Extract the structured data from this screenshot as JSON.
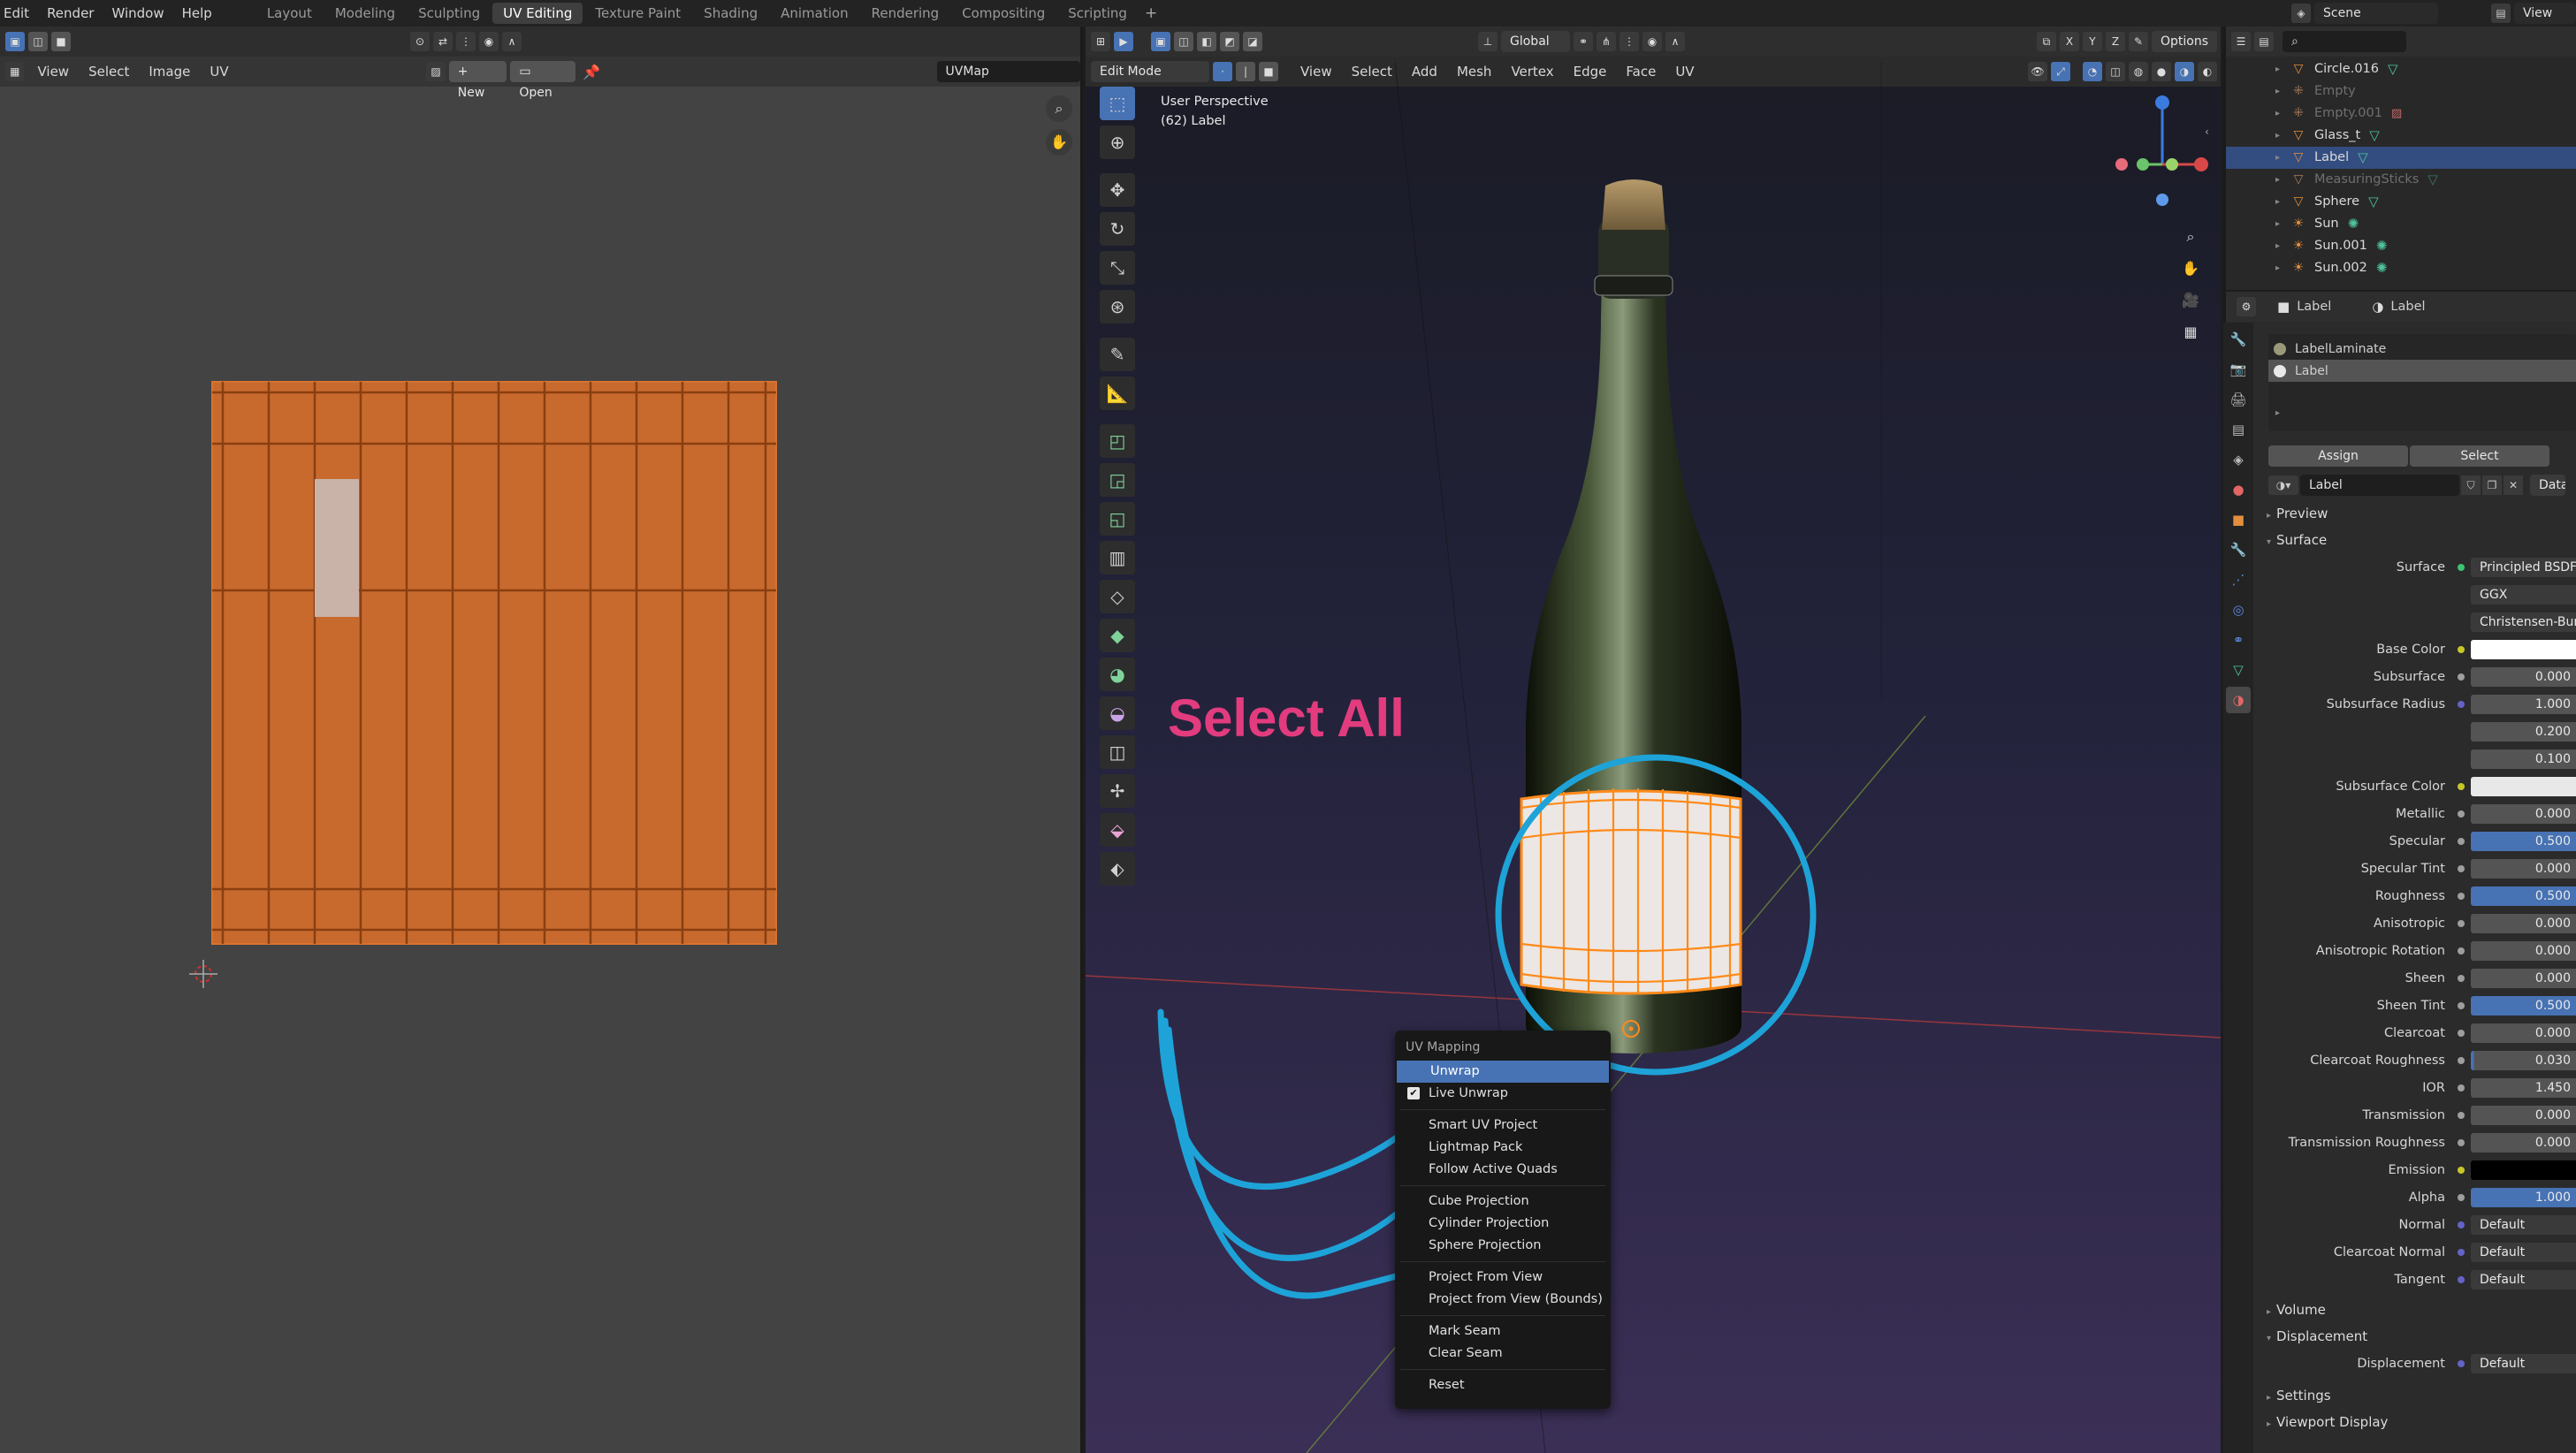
{
  "topbar": {
    "menus": [
      "Edit",
      "Render",
      "Window",
      "Help"
    ],
    "workspaces": [
      "Layout",
      "Modeling",
      "Sculpting",
      "UV Editing",
      "Texture Paint",
      "Shading",
      "Animation",
      "Rendering",
      "Compositing",
      "Scripting"
    ],
    "active_workspace": "UV Editing",
    "scene_name": "Scene",
    "view_layer": "View Lay"
  },
  "uv_editor": {
    "menus": [
      "View",
      "Select",
      "Image",
      "UV"
    ],
    "new_label": "New",
    "open_label": "Open",
    "uvmap_name": "UVMap"
  },
  "viewport": {
    "mode": "Edit Mode",
    "menus": [
      "View",
      "Select",
      "Add",
      "Mesh",
      "Vertex",
      "Edge",
      "Face",
      "UV"
    ],
    "orientation": "Global",
    "options_label": "Options",
    "axis_x": "X",
    "axis_y": "Y",
    "axis_z": "Z",
    "info_line1": "User Perspective",
    "info_line2": "(62) Label",
    "annotation": "Select All"
  },
  "uv_menu": {
    "title": "UV Mapping",
    "items": {
      "unwrap": "Unwrap",
      "live_unwrap": "Live Unwrap",
      "smart_uv": "Smart UV Project",
      "lightmap": "Lightmap Pack",
      "follow_quads": "Follow Active Quads",
      "cube": "Cube Projection",
      "cylinder": "Cylinder Projection",
      "sphere": "Sphere Projection",
      "from_view": "Project From View",
      "from_view_bounds": "Project from View (Bounds)",
      "mark_seam": "Mark Seam",
      "clear_seam": "Clear Seam",
      "reset": "Reset"
    }
  },
  "outliner": {
    "items": [
      {
        "name": "Circle.016",
        "dim": false,
        "selected": false
      },
      {
        "name": "Empty",
        "dim": true,
        "selected": false
      },
      {
        "name": "Empty.001",
        "dim": true,
        "selected": false
      },
      {
        "name": "Glass_t",
        "dim": false,
        "selected": false
      },
      {
        "name": "Label",
        "dim": false,
        "selected": true
      },
      {
        "name": "MeasuringSticks",
        "dim": true,
        "selected": false
      },
      {
        "name": "Sphere",
        "dim": false,
        "selected": false
      },
      {
        "name": "Sun",
        "dim": false,
        "selected": false
      },
      {
        "name": "Sun.001",
        "dim": false,
        "selected": false
      },
      {
        "name": "Sun.002",
        "dim": false,
        "selected": false
      }
    ]
  },
  "properties": {
    "object_name": "Label",
    "material_name": "Label",
    "slots": [
      "LabelLaminate",
      "Label"
    ],
    "assign_label": "Assign",
    "select_label": "Select",
    "material_field": "Label",
    "data_label": "Data",
    "preview_label": "Preview",
    "surface_section": "Surface",
    "surface_label": "Surface",
    "surface_value": "Principled BSDF",
    "distribution": "GGX",
    "subsurface_method": "Christensen-Burley",
    "rows": [
      {
        "label": "Base Color",
        "value": "",
        "style": "white",
        "dot": "yellow"
      },
      {
        "label": "Subsurface",
        "value": "0.000",
        "style": "",
        "dot": ""
      },
      {
        "label": "Subsurface Radius",
        "value": "1.000",
        "style": "",
        "dot": "purple"
      },
      {
        "label": "",
        "value": "0.200",
        "style": "",
        "dot": "none"
      },
      {
        "label": "",
        "value": "0.100",
        "style": "",
        "dot": "none"
      },
      {
        "label": "Subsurface Color",
        "value": "",
        "style": "lightgray",
        "dot": "yellow"
      },
      {
        "label": "Metallic",
        "value": "0.000",
        "style": "",
        "dot": ""
      },
      {
        "label": "Specular",
        "value": "0.500",
        "style": "blue",
        "dot": ""
      },
      {
        "label": "Specular Tint",
        "value": "0.000",
        "style": "",
        "dot": ""
      },
      {
        "label": "Roughness",
        "value": "0.500",
        "style": "blue",
        "dot": ""
      },
      {
        "label": "Anisotropic",
        "value": "0.000",
        "style": "",
        "dot": ""
      },
      {
        "label": "Anisotropic Rotation",
        "value": "0.000",
        "style": "",
        "dot": ""
      },
      {
        "label": "Sheen",
        "value": "0.000",
        "style": "",
        "dot": ""
      },
      {
        "label": "Sheen Tint",
        "value": "0.500",
        "style": "blue",
        "dot": ""
      },
      {
        "label": "Clearcoat",
        "value": "0.000",
        "style": "",
        "dot": ""
      },
      {
        "label": "Clearcoat Roughness",
        "value": "0.030",
        "style": "",
        "dot": ""
      },
      {
        "label": "IOR",
        "value": "1.450",
        "style": "",
        "dot": ""
      },
      {
        "label": "Transmission",
        "value": "0.000",
        "style": "",
        "dot": ""
      },
      {
        "label": "Transmission Roughness",
        "value": "0.000",
        "style": "",
        "dot": ""
      },
      {
        "label": "Emission",
        "value": "",
        "style": "black",
        "dot": "yellow"
      },
      {
        "label": "Alpha",
        "value": "1.000",
        "style": "blue",
        "dot": ""
      },
      {
        "label": "Normal",
        "value": "Default",
        "style": "dark",
        "dot": "purple"
      },
      {
        "label": "Clearcoat Normal",
        "value": "Default",
        "style": "dark",
        "dot": "purple"
      },
      {
        "label": "Tangent",
        "value": "Default",
        "style": "dark",
        "dot": "purple"
      }
    ],
    "volume_section": "Volume",
    "displacement_section": "Displacement",
    "displacement_label": "Displacement",
    "displacement_value": "Default",
    "settings_section": "Settings",
    "viewport_display_section": "Viewport Display"
  }
}
